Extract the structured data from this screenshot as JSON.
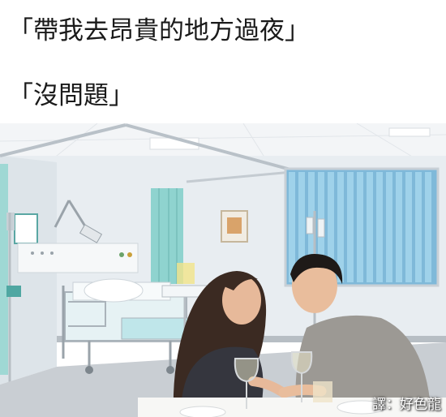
{
  "caption": {
    "line1": "「帶我去昂貴的地方過夜」",
    "line2": "「沒問題」"
  },
  "photo": {
    "scene": "hospital-room-couple-dinner",
    "colors": {
      "wall": "#e9eef2",
      "ceiling": "#f4f6f8",
      "curtain": "#8fd3cf",
      "blinds": "#8fc9e6",
      "floor": "#c9ced3"
    }
  },
  "credit": {
    "text": "譯：好色龍"
  }
}
